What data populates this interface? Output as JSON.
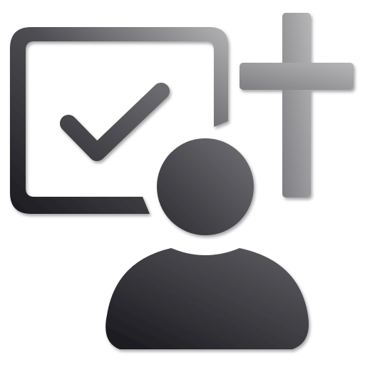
{
  "icon": {
    "name": "confirm-religious-user",
    "parts": [
      "checklist-board-icon",
      "check-mark-icon",
      "cross-icon",
      "user-icon"
    ]
  },
  "colors": {
    "dark": "#1b1b20",
    "mid": "#5d5d62",
    "light": "#a9a9ab",
    "shadow": "#7a7a7e",
    "background": "#ffffff"
  }
}
